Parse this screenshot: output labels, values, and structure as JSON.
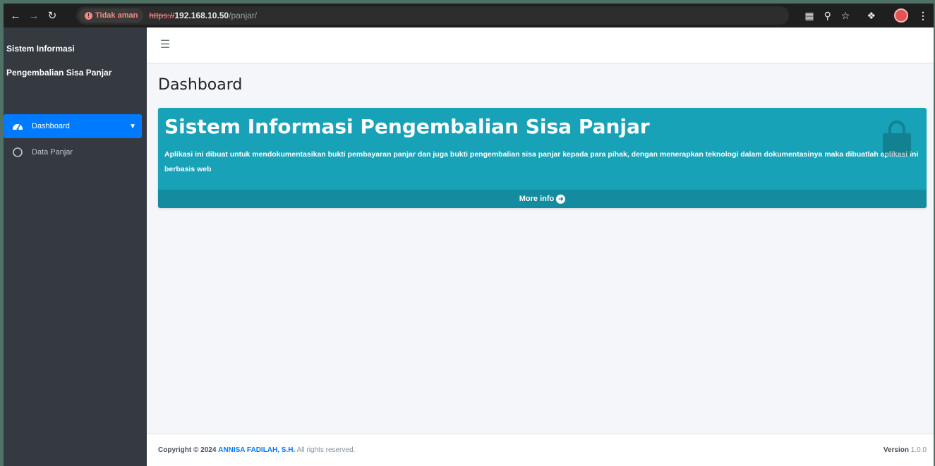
{
  "browser": {
    "security_label": "Tidak aman",
    "url_scheme": "https://",
    "url_host": "192.168.10.50",
    "url_path": "/panjar/"
  },
  "sidebar": {
    "brand_line1": "Sistem Informasi",
    "brand_line2": "Pengembalian Sisa Panjar",
    "items": [
      {
        "label": "Dashboard",
        "active": true,
        "icon": "dashboard-icon"
      },
      {
        "label": "Data Panjar",
        "active": false,
        "icon": "circle-icon"
      }
    ]
  },
  "main": {
    "page_title": "Dashboard",
    "info_box": {
      "title": "Sistem Informasi Pengembalian Sisa Panjar",
      "description": "Aplikasi ini dibuat untuk mendokumentasikan bukti pembayaran panjar dan juga bukti pengembalian sisa panjar kepada para pihak, dengan menerapkan teknologi dalam dokumentasinya maka dibuatlah aplikasi ini berbasis web",
      "more_info_label": "More info",
      "icon": "shopping-bag-icon"
    }
  },
  "footer": {
    "copyright_prefix": "Copyright © 2024",
    "author": "ANNISA FADILAH, S.H.",
    "rights": "All rights reserved.",
    "version_label": "Version",
    "version_value": "1.0.0"
  },
  "colors": {
    "sidebar_bg": "#343a40",
    "active_item": "#007bff",
    "info_box": "#17a2b8",
    "content_bg": "#f4f6f9"
  }
}
